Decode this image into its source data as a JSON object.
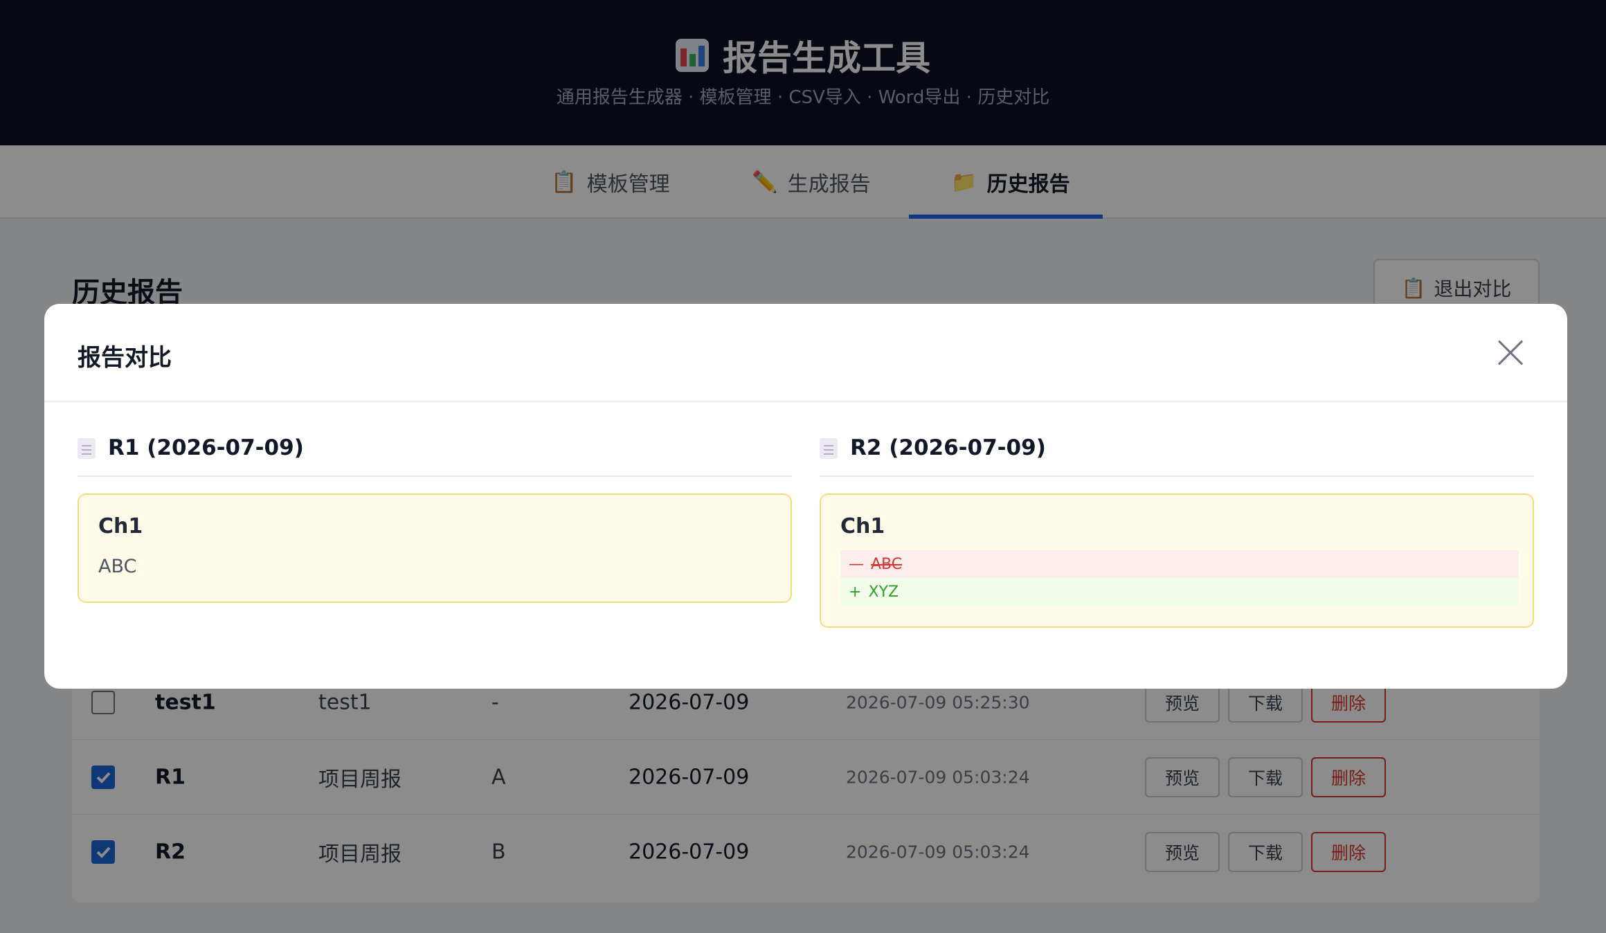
{
  "app": {
    "title": "报告生成工具",
    "subtitle": "通用报告生成器 · 模板管理 · CSV导入 · Word导出 · 历史对比"
  },
  "nav": {
    "tabs": [
      {
        "icon": "📋",
        "label": "模板管理"
      },
      {
        "icon": "✏️",
        "label": "生成报告"
      },
      {
        "icon": "📁",
        "label": "历史报告",
        "active": true
      }
    ]
  },
  "history": {
    "title": "历史报告",
    "exit_compare_icon": "📋",
    "exit_compare_label": "退出对比",
    "rows": [
      {
        "checked": false,
        "name": "test1",
        "template": "test1",
        "version": "-",
        "date": "2026-07-09",
        "created": "2026-07-09 05:25:30"
      },
      {
        "checked": true,
        "name": "R1",
        "template": "项目周报",
        "version": "A",
        "date": "2026-07-09",
        "created": "2026-07-09 05:03:24"
      },
      {
        "checked": true,
        "name": "R2",
        "template": "项目周报",
        "version": "B",
        "date": "2026-07-09",
        "created": "2026-07-09 05:03:24"
      }
    ],
    "actions": {
      "preview": "预览",
      "download": "下载",
      "delete": "删除"
    }
  },
  "modal": {
    "title": "报告对比",
    "left": {
      "heading": "R1 (2026-07-09)",
      "chapter": "Ch1",
      "text": "ABC"
    },
    "right": {
      "heading": "R2 (2026-07-09)",
      "chapter": "Ch1",
      "removed_marker": "—",
      "removed_text": "ABC",
      "added_marker": "+",
      "added_text": "XYZ"
    }
  },
  "colors": {
    "header_bg": "#0c1024",
    "accent": "#2563eb",
    "danger": "#d9362b",
    "success": "#2fa12b",
    "chapter_bg": "#fffbe8"
  }
}
